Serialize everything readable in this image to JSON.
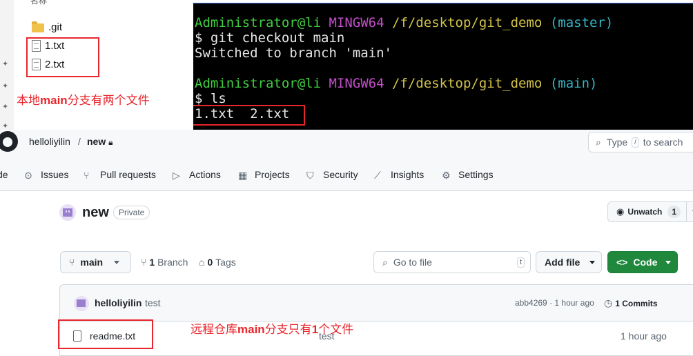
{
  "explorer": {
    "header_fragment": "名称",
    "items": [
      {
        "name": ".git",
        "icon": "folder-icon"
      },
      {
        "name": "1.txt",
        "icon": "text-file-icon"
      },
      {
        "name": "2.txt",
        "icon": "text-file-icon"
      }
    ],
    "annotation": {
      "pre": "本地",
      "bold": "main",
      "post": "分支有两个文件"
    }
  },
  "terminal": {
    "prompt_user": "Administrator@li",
    "prompt_env": "MINGW64",
    "prompt_path": "/f/desktop/git_demo",
    "branch_before": "(master)",
    "cmd1": "$ git checkout main",
    "out1": "Switched to branch 'main'",
    "branch_after": "(main)",
    "cmd2": "$ ls",
    "out2": "1.txt  2.txt"
  },
  "github": {
    "owner": "helloliyilin",
    "separator": "/",
    "repo": "new",
    "search_pre": "Type",
    "search_key": "/",
    "search_post": "to search",
    "tabs": [
      {
        "label": "de",
        "icon": ""
      },
      {
        "label": "Issues",
        "icon": "issue-icon"
      },
      {
        "label": "Pull requests",
        "icon": "pull-request-icon"
      },
      {
        "label": "Actions",
        "icon": "play-icon"
      },
      {
        "label": "Projects",
        "icon": "table-icon"
      },
      {
        "label": "Security",
        "icon": "shield-icon"
      },
      {
        "label": "Insights",
        "icon": "graph-icon"
      },
      {
        "label": "Settings",
        "icon": "gear-icon"
      }
    ],
    "repo_title": "new",
    "visibility": "Private",
    "unwatch_label": "Unwatch",
    "unwatch_count": "1",
    "branch_select": "main",
    "branch_count": "1",
    "branch_label": "Branch",
    "tag_count": "0",
    "tag_label": "Tags",
    "goto_placeholder": "Go to file",
    "goto_key": "t",
    "add_file_label": "Add file",
    "code_label": "Code",
    "commit_author": "helloliyilin",
    "commit_message": "test",
    "commit_sha": "abb4269",
    "commit_dot": "·",
    "commit_time": "1 hour ago",
    "commits_count": "1",
    "commits_label": "Commits",
    "files": [
      {
        "name": "readme.txt",
        "message": "test",
        "time": "1 hour ago"
      }
    ],
    "annotation": {
      "pre": "远程仓库",
      "bold": "main",
      "mid": "分支只有",
      "bold2": "1",
      "post": "个文件"
    }
  },
  "colors": {
    "annotation_red": "#e8262c",
    "terminal_green": "#3fce3f",
    "terminal_purple": "#c04ec7",
    "terminal_yellow": "#d3c34a",
    "terminal_cyan": "#35b6c4",
    "code_button_green": "#1f883d"
  }
}
